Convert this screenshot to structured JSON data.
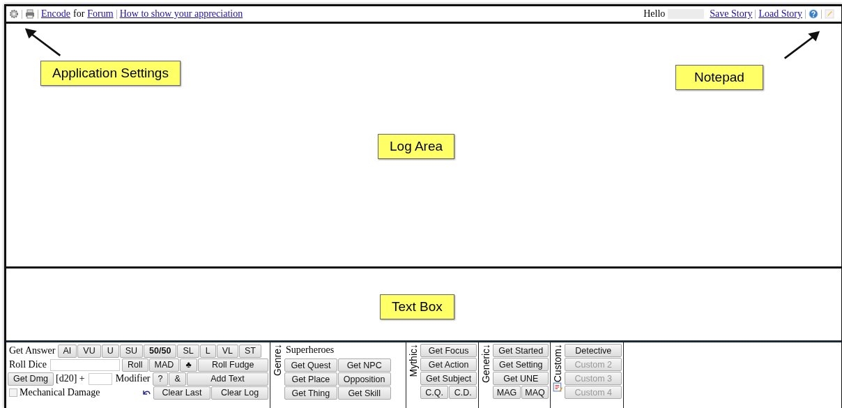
{
  "toolbar": {
    "encode_link": "Encode",
    "for_text": "for",
    "forum_link": "Forum",
    "appreciation_link": "How to show your appreciation",
    "greeting": "Hello",
    "save_link": "Save Story",
    "load_link": "Load Story"
  },
  "annotations": [
    {
      "text": "Application Settings"
    },
    {
      "text": "Notepad"
    },
    {
      "text": "Log Area"
    },
    {
      "text": "Text Box"
    }
  ],
  "answer": {
    "label": "Get Answer",
    "buttons": [
      "AI",
      "VU",
      "U",
      "SU",
      "50/50",
      "SL",
      "L",
      "VL",
      "ST"
    ]
  },
  "dice": {
    "label": "Roll Dice",
    "buttons": [
      "Roll",
      "MAD",
      "♣",
      "Roll Fudge"
    ]
  },
  "damage": {
    "button": "Get Dmg",
    "dice_text": "[d20] +",
    "modifier_label": "Modifier",
    "buttons": [
      "?",
      "&",
      "Add Text"
    ]
  },
  "mechanical": {
    "label": "Mechanical Damage",
    "checked": false,
    "buttons": [
      "Clear Last",
      "Clear Log"
    ]
  },
  "genre": {
    "label": "Genre↓",
    "title": "Superheroes",
    "buttons": [
      "Get Quest",
      "Get NPC",
      "Get Place",
      "Opposition",
      "Get Thing",
      "Get Skill"
    ]
  },
  "mythic": {
    "label": "Mythic↓",
    "buttons": [
      "Get Focus",
      "Get Action",
      "Get Subject"
    ],
    "small_buttons": [
      "C.Q.",
      "C.D."
    ]
  },
  "generic": {
    "label": "Generic↓",
    "buttons": [
      "Get Started",
      "Get Setting",
      "Get UNE"
    ],
    "small_buttons": [
      "MAG",
      "MAQ"
    ]
  },
  "custom": {
    "label": "Custom↓",
    "buttons": [
      {
        "label": "Detective",
        "disabled": false
      },
      {
        "label": "Custom 2",
        "disabled": true
      },
      {
        "label": "Custom 3",
        "disabled": true
      },
      {
        "label": "Custom 4",
        "disabled": true
      }
    ]
  }
}
